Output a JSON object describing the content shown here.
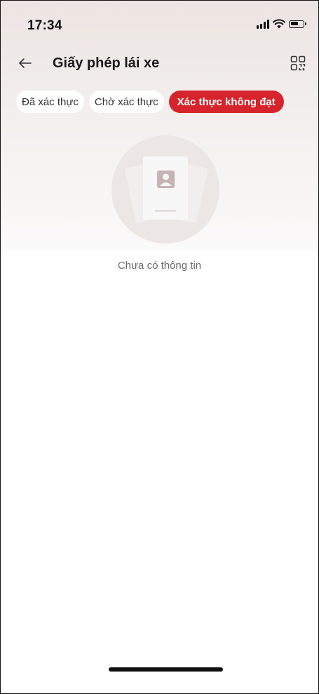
{
  "status_bar": {
    "time": "17:34",
    "icons": [
      "signal-icon",
      "wifi-icon",
      "battery-icon"
    ]
  },
  "header": {
    "back_icon": "arrow-left-icon",
    "title": "Giấy phép lái xe",
    "qr_icon": "qr-scan-icon"
  },
  "tabs": [
    {
      "label": "Đã xác thực",
      "active": false
    },
    {
      "label": "Chờ xác thực",
      "active": false
    },
    {
      "label": "Xác thực không đạt",
      "active": true
    }
  ],
  "empty_state": {
    "icon": "id-card-placeholder-icon",
    "message": "Chưa có thông tin"
  },
  "colors": {
    "accent": "#d6242c",
    "text_primary": "#1a1a1a",
    "text_secondary": "#6a6a6a"
  }
}
